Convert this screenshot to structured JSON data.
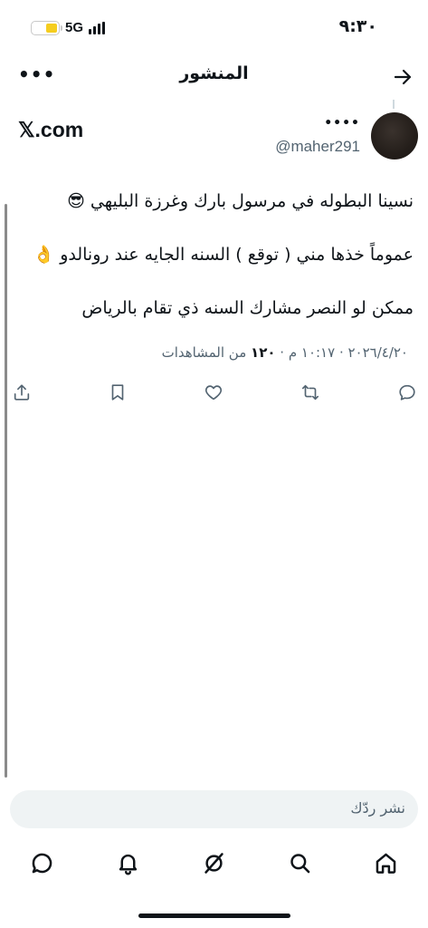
{
  "status_bar": {
    "time": "٩:٣٠",
    "network": "5G",
    "battery_level_percent": 45,
    "battery_color": "#f5cd1f"
  },
  "header": {
    "title": "المنشور",
    "back_icon": "arrow-right-icon",
    "more_icon": "more-dots-icon",
    "more_label": "•••"
  },
  "post": {
    "source": "𝕏.com",
    "author_name": "••••",
    "author_handle": "@maher291",
    "lines": [
      "نسينا البطوله في مرسول بارك وغرزة البليهي 😎",
      "عموماً خذها مني ( توقع ) السنه الجايه عند رونالدو 👌",
      "ممكن لو النصر مشارك السنه ذي تقام بالرياض"
    ],
    "meta": {
      "date": "٢٠٢٦/٤/٢٠",
      "separator": " · ",
      "time": "١٠:١٧ م",
      "views_count": "١٢٠",
      "views_label": "من المشاهدات"
    },
    "actions": [
      {
        "name": "reply",
        "icon": "reply-icon"
      },
      {
        "name": "repost",
        "icon": "repost-icon"
      },
      {
        "name": "like",
        "icon": "heart-icon"
      },
      {
        "name": "bookmark",
        "icon": "bookmark-icon"
      },
      {
        "name": "share",
        "icon": "share-icon"
      }
    ]
  },
  "reply_box": {
    "placeholder": "نشر ردّك"
  },
  "bottom_nav": [
    {
      "name": "home",
      "icon": "home-icon"
    },
    {
      "name": "search",
      "icon": "search-icon"
    },
    {
      "name": "grok",
      "icon": "grok-icon"
    },
    {
      "name": "notifications",
      "icon": "bell-icon"
    },
    {
      "name": "messages",
      "icon": "chat-bubble-icon"
    }
  ],
  "colors": {
    "text": "#0f1419",
    "secondary": "#536471",
    "input_bg": "#eff3f4"
  }
}
